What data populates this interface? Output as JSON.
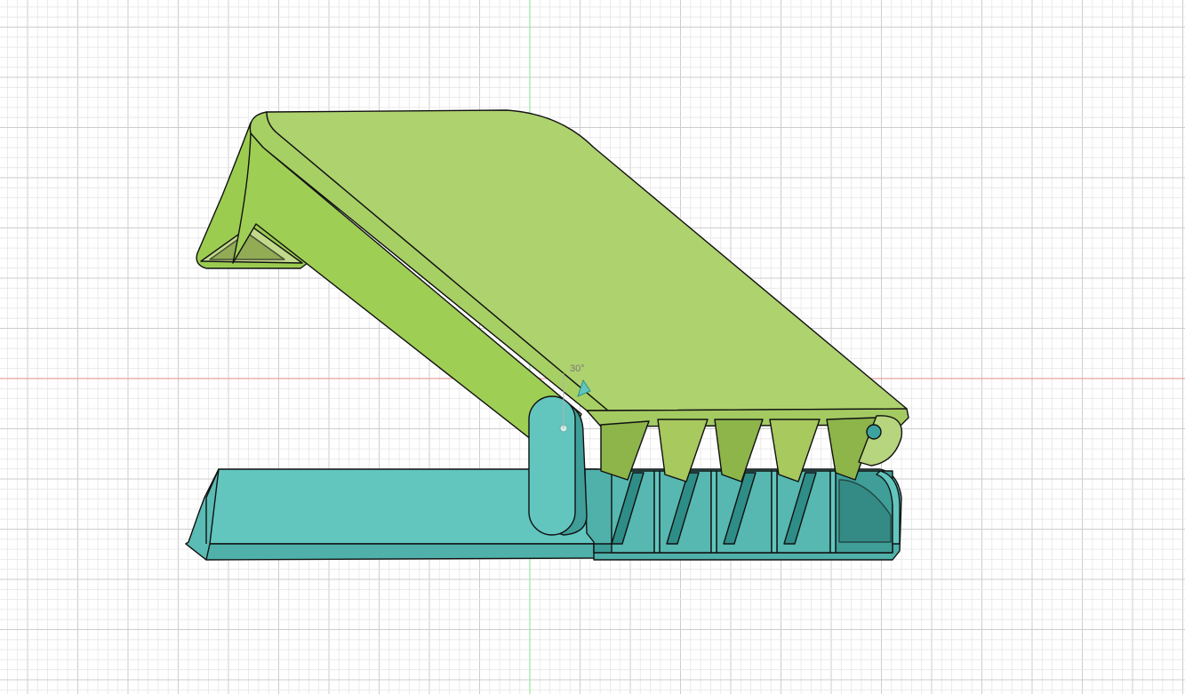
{
  "viewport": {
    "background": "#ffffff",
    "grid_minor_color": "#e6e6e6",
    "grid_major_color": "#cdcdcd",
    "axis_x_color": "#f0a0a0",
    "axis_y_color": "#98e898"
  },
  "model": {
    "top_part_color": "#aed26e",
    "top_part_shade_color": "#8db54a",
    "bottom_part_color": "#62c6bf",
    "bottom_part_shade_color": "#3a9a94",
    "edge_color": "#111111"
  },
  "dimension": {
    "angle_label": "30°"
  }
}
